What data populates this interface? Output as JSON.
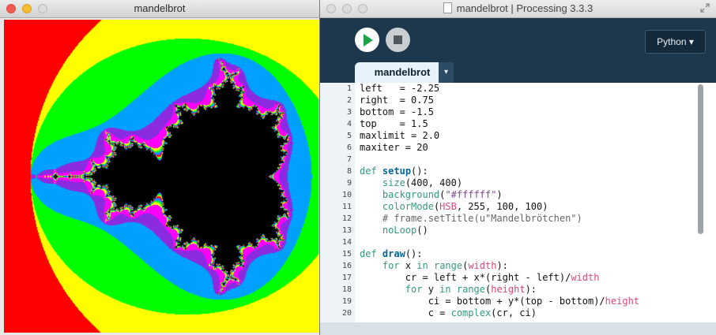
{
  "sketch_window": {
    "title": "mandelbrot"
  },
  "ide_window": {
    "title": "mandelbrot | Processing 3.3.3",
    "mode": "Python ▾",
    "tab_label": "mandelbrot",
    "tab_menu": "▾"
  },
  "colors": {
    "run_green": "#1fa34a",
    "ide_background": "#1d384d",
    "mandel_palette": [
      "#ff0000",
      "#ffff00",
      "#00ff00",
      "#00a0ff",
      "#8a2be2",
      "#ff00ff",
      "#000000"
    ]
  },
  "code": {
    "lines": [
      "left   = -2.25",
      "right  = 0.75",
      "bottom = -1.5",
      "top    = 1.5",
      "maxlimit = 2.0",
      "maxiter = 20",
      "",
      "def setup():",
      "    size(400, 400)",
      "    background(\"#ffffff\")",
      "    colorMode(HSB, 255, 100, 100)",
      "    # frame.setTitle(u\"Mandelbrötchen\")",
      "    noLoop()",
      "",
      "def draw():",
      "    for x in range(width):",
      "        cr = left + x*(right - left)/width",
      "        for y in range(height):",
      "            ci = bottom + y*(top - bottom)/height",
      "            c = complex(cr, ci)"
    ],
    "line_numbers": [
      "1",
      "2",
      "3",
      "4",
      "5",
      "6",
      "7",
      "8",
      "9",
      "10",
      "11",
      "12",
      "13",
      "14",
      "15",
      "16",
      "17",
      "18",
      "19",
      "20"
    ]
  },
  "icons": {
    "run": "play-icon",
    "stop": "stop-icon",
    "fullscreen": "fullscreen-icon",
    "document": "document-icon"
  }
}
